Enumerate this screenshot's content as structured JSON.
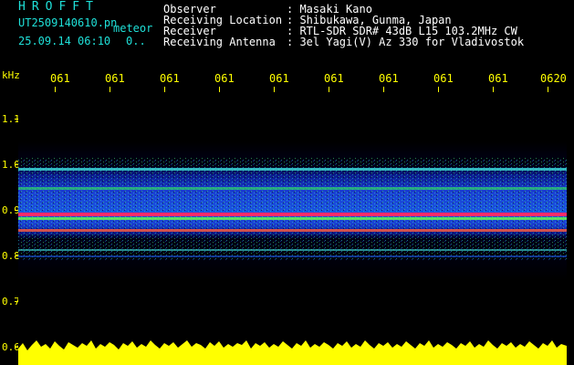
{
  "header": {
    "app_title": "HROFFT",
    "file_name": "UT2509140610.pn",
    "file_type": "meteor",
    "datetime": "25.09.14 06:10",
    "count": "0.."
  },
  "info": {
    "labels": [
      "Observer",
      "Receiving Location",
      "Receiver",
      "Receiving Antenna"
    ],
    "values": [
      ": Masaki Kano",
      ": Shibukawa, Gunma, Japan",
      ": RTL-SDR SDR# 43dB L15 103.2MHz CW",
      ": 3el Yagi(V) Az 330 for Vladivostok"
    ]
  },
  "y_axis": {
    "unit": "kHz",
    "labels": [
      "1.1",
      "1.0",
      "0.9",
      "0.8",
      "0.7",
      "0.6"
    ]
  },
  "x_axis": {
    "labels": [
      "061",
      "061",
      "061",
      "061",
      "061",
      "061",
      "061",
      "061",
      "061",
      "0620"
    ]
  },
  "colors": {
    "accent": "#1fe0d8",
    "axis": "#ffff00",
    "text": "#ffffff"
  }
}
